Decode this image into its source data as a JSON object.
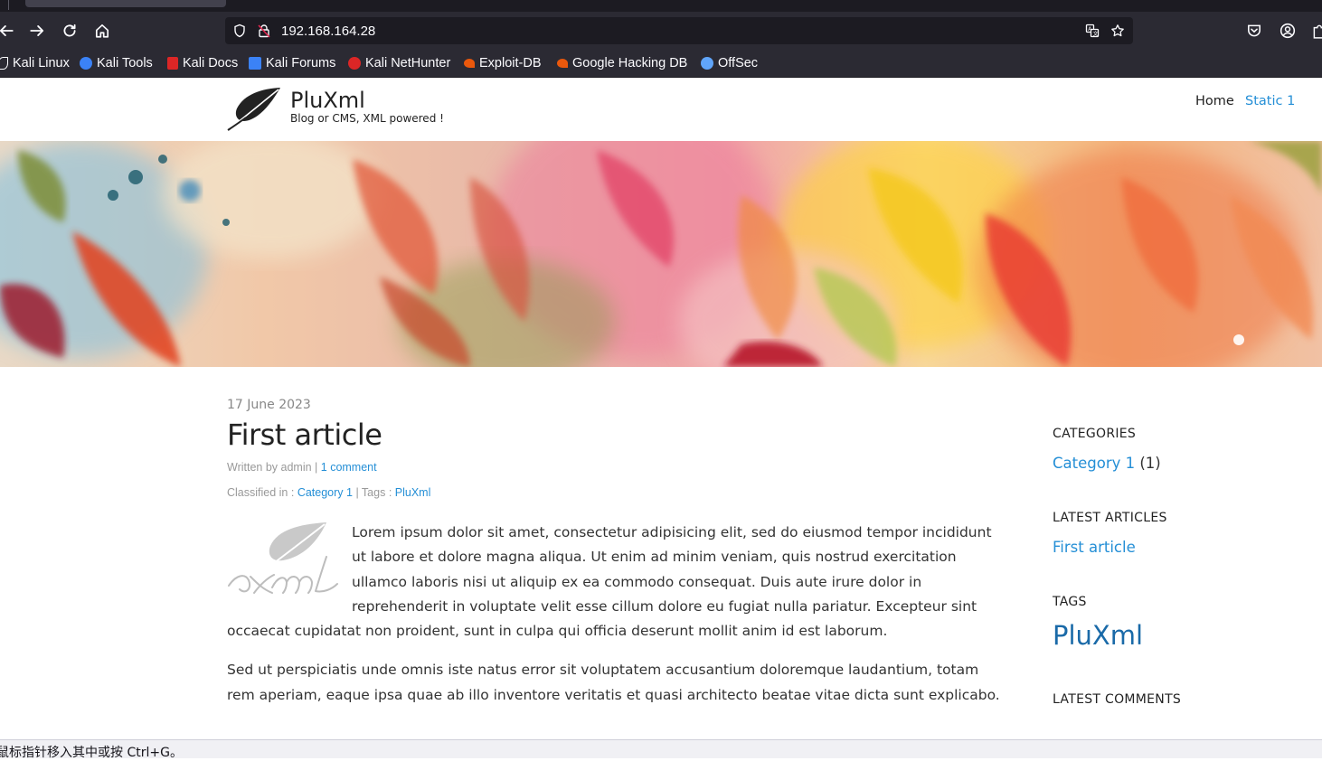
{
  "browser": {
    "url": "192.168.164.28",
    "bookmarks": [
      {
        "label": "Kali Linux",
        "icon": "kali-dragon-icon",
        "color": "#ffffff"
      },
      {
        "label": "Kali Tools",
        "icon": "kali-tools-icon",
        "color": "#3b82f6"
      },
      {
        "label": "Kali Docs",
        "icon": "kali-docs-icon",
        "color": "#dc2626"
      },
      {
        "label": "Kali Forums",
        "icon": "kali-forums-icon",
        "color": "#3b82f6"
      },
      {
        "label": "Kali NetHunter",
        "icon": "nethunter-icon",
        "color": "#dc2626"
      },
      {
        "label": "Exploit-DB",
        "icon": "exploit-db-icon",
        "color": "#ea580c"
      },
      {
        "label": "Google Hacking DB",
        "icon": "ghdb-icon",
        "color": "#ea580c"
      },
      {
        "label": "OffSec",
        "icon": "offsec-icon",
        "color": "#60a5fa"
      }
    ]
  },
  "site": {
    "title": "PluXml",
    "subtitle": "Blog or CMS, XML powered !",
    "menu": [
      {
        "label": "Home",
        "active": false
      },
      {
        "label": "Static 1",
        "active": true
      }
    ]
  },
  "article": {
    "date": "17 June 2023",
    "title": "First article",
    "written_by": "Written by admin",
    "sep": " | ",
    "comments": "1 comment",
    "classified": "Classified in : ",
    "category": "Category 1",
    "tags_label": " | Tags : ",
    "tag": "PluXml",
    "para1": "Lorem ipsum dolor sit amet, consectetur adipisicing elit, sed do eiusmod tempor incididunt ut labore et dolore magna aliqua. Ut enim ad minim veniam, quis nostrud exercitation ullamco laboris nisi ut aliquip ex ea commodo consequat. Duis aute irure dolor in reprehenderit in voluptate velit esse cillum dolore eu fugiat nulla pariatur. Excepteur sint occaecat cupidatat non proident, sunt in culpa qui officia deserunt mollit anim id est laborum.",
    "para2": "Sed ut perspiciatis unde omnis iste natus error sit voluptatem accusantium doloremque laudantium, totam rem aperiam, eaque ipsa quae ab illo inventore veritatis et quasi architecto beatae vitae dicta sunt explicabo."
  },
  "sidebar": {
    "categories_heading": "CATEGORIES",
    "category_link": "Category 1",
    "category_count": " (1)",
    "latest_articles_heading": "LATEST ARTICLES",
    "latest_article": "First article",
    "tags_heading": "TAGS",
    "tag": "PluXml",
    "latest_comments_heading": "LATEST COMMENTS"
  },
  "status": {
    "text": "鼠标指针移入其中或按 Ctrl+G。"
  },
  "colors": {
    "link": "#258fd6",
    "tag": "#1a6aa8",
    "chrome_bg": "#2b2a33"
  }
}
